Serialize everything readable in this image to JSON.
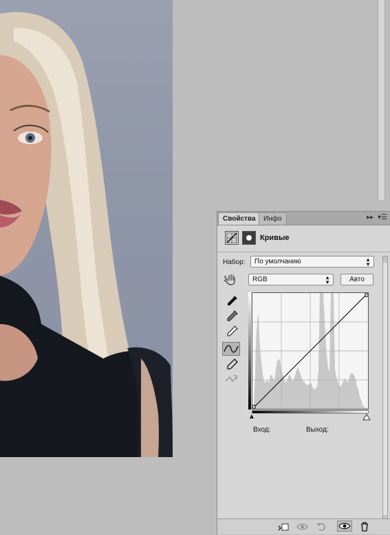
{
  "panel": {
    "tabs": [
      {
        "label": "Свойства",
        "active": true
      },
      {
        "label": "Инфо",
        "active": false
      }
    ],
    "collapse_icon": "double-arrow-right-icon",
    "menu_icon": "panel-menu-icon",
    "header": {
      "title": "Кривые",
      "adjustment_icon": "curves-adjustment-icon",
      "mask_icon": "layer-mask-icon"
    },
    "preset": {
      "label": "Набор:",
      "value": "По умолчанию"
    },
    "channel": {
      "value": "RGB"
    },
    "auto_button": "Авто",
    "tools": [
      "black-point-eyedropper-icon",
      "gray-point-eyedropper-icon",
      "white-point-eyedropper-icon",
      "curve-points-tool-icon",
      "pencil-draw-icon",
      "smooth-curve-icon"
    ],
    "input_label": "Вход:",
    "output_label": "Выход:",
    "bottom_icons": [
      "clip-to-layer-icon",
      "view-previous-state-icon",
      "reset-icon",
      "visibility-eye-icon",
      "trash-icon"
    ]
  },
  "colors": {
    "panel_bg": "#d6d6d6",
    "workspace_bg": "#bdbdbd",
    "photo_bg": "#8f96a8"
  }
}
